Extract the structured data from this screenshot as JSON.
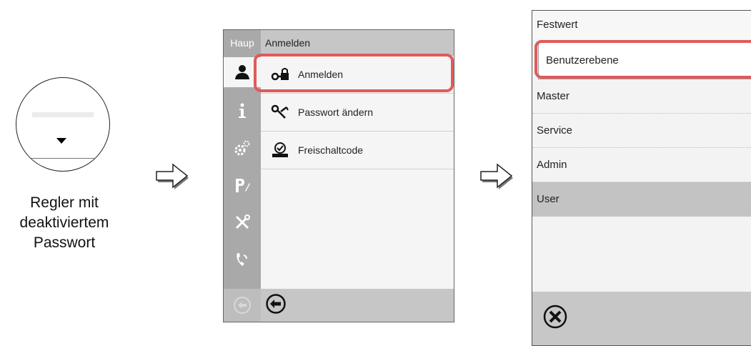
{
  "knob": {
    "caption_line1": "Regler mit",
    "caption_line2": "deaktiviertem",
    "caption_line3": "Passwort"
  },
  "screen1": {
    "main_tab_label": "Haup",
    "header_title": "Anmelden",
    "menu_items": [
      {
        "label": "Anmelden",
        "icon": "key-lock-icon"
      },
      {
        "label": "Passwort ändern",
        "icon": "keys-icon"
      },
      {
        "label": "Freischaltcode",
        "icon": "unlock-code-icon"
      }
    ],
    "sidebar_icons": [
      "user-icon",
      "info-icon",
      "settings-icon",
      "program-icon",
      "service-tools-icon",
      "phone-icon"
    ],
    "highlight_color": "#e05a5a"
  },
  "screen2": {
    "title": "Festwert",
    "input_value": "Benutzerebene",
    "options": [
      {
        "label": "Master",
        "selected": false
      },
      {
        "label": "Service",
        "selected": false
      },
      {
        "label": "Admin",
        "selected": false
      },
      {
        "label": "User",
        "selected": true
      }
    ]
  }
}
